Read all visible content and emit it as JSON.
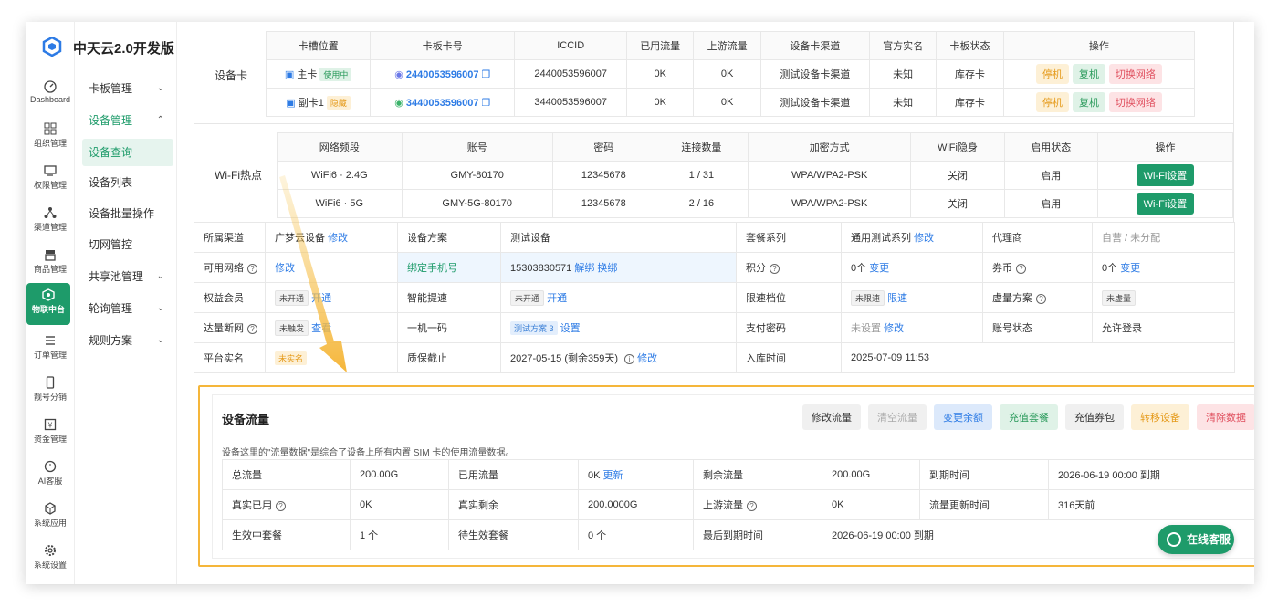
{
  "app": {
    "title": "中天云2.0开发版"
  },
  "rail": [
    {
      "label": "Dashboard",
      "icon": "dashboard-icon"
    },
    {
      "label": "组织管理",
      "icon": "grid-icon"
    },
    {
      "label": "权限管理",
      "icon": "monitor-icon"
    },
    {
      "label": "渠道管理",
      "icon": "network-icon"
    },
    {
      "label": "商品管理",
      "icon": "store-icon"
    },
    {
      "label": "物联中台",
      "icon": "iot-icon"
    },
    {
      "label": "订单管理",
      "icon": "list-icon"
    },
    {
      "label": "靓号分销",
      "icon": "phone-icon"
    },
    {
      "label": "资金管理",
      "icon": "money-icon"
    },
    {
      "label": "AI客服",
      "icon": "ai-icon"
    },
    {
      "label": "系统应用",
      "icon": "cube-icon"
    },
    {
      "label": "系统设置",
      "icon": "gear-icon"
    }
  ],
  "menu": [
    {
      "label": "卡板管理",
      "arrow": "⌄"
    },
    {
      "label": "设备管理",
      "arrow": "⌃"
    },
    {
      "label": "设备查询",
      "arrow": ""
    },
    {
      "label": "设备列表",
      "arrow": ""
    },
    {
      "label": "设备批量操作",
      "arrow": ""
    },
    {
      "label": "切网管控",
      "arrow": ""
    },
    {
      "label": "共享池管理",
      "arrow": "⌄"
    },
    {
      "label": "轮询管理",
      "arrow": "⌄"
    },
    {
      "label": "规则方案",
      "arrow": "⌄"
    }
  ],
  "device_card": {
    "label": "设备卡",
    "headers": [
      "卡槽位置",
      "卡板卡号",
      "ICCID",
      "已用流量",
      "上游流量",
      "设备卡渠道",
      "官方实名",
      "卡板状态",
      "操作"
    ],
    "rows": [
      {
        "slot": "主卡",
        "slot_tag": "使用中",
        "card": "2440053596007",
        "iccid": "2440053596007",
        "used": "0K",
        "upstream": "0K",
        "channel": "测试设备卡渠道",
        "realname": "未知",
        "status": "库存卡",
        "ops": [
          "停机",
          "复机",
          "切换网络"
        ]
      },
      {
        "slot": "副卡1",
        "slot_tag": "隐藏",
        "card": "3440053596007",
        "iccid": "3440053596007",
        "used": "0K",
        "upstream": "0K",
        "channel": "测试设备卡渠道",
        "realname": "未知",
        "status": "库存卡",
        "ops": [
          "停机",
          "复机",
          "切换网络"
        ]
      }
    ]
  },
  "wifi": {
    "label": "Wi-Fi热点",
    "headers": [
      "网络频段",
      "账号",
      "密码",
      "连接数量",
      "加密方式",
      "WiFi隐身",
      "启用状态",
      "操作"
    ],
    "rows": [
      {
        "band": "WiFi6 · 2.4G",
        "account": "GMY-80170",
        "password": "12345678",
        "conn": "1 / 31",
        "enc": "WPA/WPA2-PSK",
        "hidden": "关闭",
        "enabled": "启用",
        "op": "Wi-Fi设置"
      },
      {
        "band": "WiFi6 · 5G",
        "account": "GMY-5G-80170",
        "password": "12345678",
        "conn": "2 / 16",
        "enc": "WPA/WPA2-PSK",
        "hidden": "关闭",
        "enabled": "启用",
        "op": "Wi-Fi设置"
      }
    ]
  },
  "info": {
    "r1": {
      "k1": "所属渠道",
      "v1": "广梦云设备",
      "l1": "修改",
      "k2": "设备方案",
      "v2": "测试设备",
      "k3": "套餐系列",
      "v3": "通用测试系列",
      "l3": "修改",
      "k4": "代理商",
      "v4": "自营 / 未分配"
    },
    "r2": {
      "k1": "可用网络",
      "l1": "修改",
      "k2": "绑定手机号",
      "v2": "15303830571",
      "l2a": "解绑",
      "l2b": "换绑",
      "k3": "积分",
      "v3": "0个",
      "l3": "变更",
      "k4": "券币",
      "v4": "0个",
      "l4": "变更"
    },
    "r3": {
      "k1": "权益会员",
      "t1": "未开通",
      "l1": "开通",
      "k2": "智能提速",
      "t2": "未开通",
      "l2": "开通",
      "k3": "限速档位",
      "t3": "未限速",
      "l3": "限速",
      "k4": "虚量方案",
      "t4": "未虚量"
    },
    "r4": {
      "k1": "达量断网",
      "t1": "未触发",
      "l1": "查看",
      "k2": "一机一码",
      "t2": "测试方案 3",
      "l2": "设置",
      "k3": "支付密码",
      "v3": "未设置",
      "l3": "修改",
      "k4": "账号状态",
      "v4": "允许登录"
    },
    "r5": {
      "k1": "平台实名",
      "t1": "未实名",
      "k2": "质保截止",
      "v2": "2027-05-15 (剩余359天)",
      "l2": "修改",
      "k3": "入库时间",
      "v3": "2025-07-09 11:53"
    }
  },
  "flow": {
    "title": "设备流量",
    "buttons": [
      "修改流量",
      "清空流量",
      "变更余额",
      "充值套餐",
      "充值券包",
      "转移设备",
      "清除数据"
    ],
    "desc": "设备这里的\"流量数据\"是综合了设备上所有内置 SIM 卡的使用流量数据。",
    "r1": {
      "k1": "总流量",
      "v1": "200.00G",
      "k2": "已用流量",
      "v2": "0K",
      "l2": "更新",
      "k3": "剩余流量",
      "v3": "200.00G",
      "k4": "到期时间",
      "v4": "2026-06-19 00:00 到期"
    },
    "r2": {
      "k1": "真实已用",
      "v1": "0K",
      "k2": "真实剩余",
      "v2": "200.0000G",
      "k3": "上游流量",
      "v3": "0K",
      "k4": "流量更新时间",
      "v4": "316天前"
    },
    "r3": {
      "k1": "生效中套餐",
      "v1": "1 个",
      "k2": "待生效套餐",
      "v2": "0 个",
      "k3": "最后到期时间",
      "v3": "2026-06-19 00:00 到期"
    }
  },
  "service": {
    "label": "在线客服"
  },
  "colors": {
    "accent": "#1e9b6a",
    "highlight": "#f5b63a",
    "link": "#2d7be5"
  }
}
